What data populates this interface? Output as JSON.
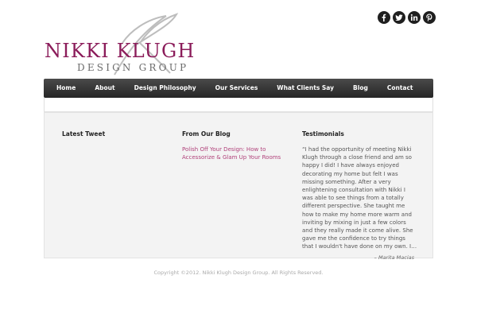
{
  "social": {
    "facebook": "facebook-icon",
    "twitter": "twitter-icon",
    "linkedin": "linkedin-icon",
    "pinterest": "pinterest-icon"
  },
  "logo": {
    "name": "NIKKI KLUGH",
    "subtitle": "DESIGN GROUP",
    "name_color": "#8b1c5a"
  },
  "nav": {
    "items": [
      {
        "label": "Home"
      },
      {
        "label": "About"
      },
      {
        "label": "Design Philosophy"
      },
      {
        "label": "Our Services"
      },
      {
        "label": "What Clients Say"
      },
      {
        "label": "Blog"
      },
      {
        "label": "Contact"
      }
    ]
  },
  "widgets": {
    "latest_tweet": {
      "title": "Latest Tweet"
    },
    "blog": {
      "title": "From Our Blog",
      "link": "Polish Off Your Design: How to Accessorize & Glam Up Your Rooms"
    },
    "testimonials": {
      "title": "Testimonials",
      "quote": "“I had the opportunity of meeting Nikki Klugh through a close friend and am so happy I did!  I have always enjoyed decorating my home but felt I was missing something.  After a very enlightening consultation with Nikki I was able to see things from a totally different perspective.  She taught me how to make my home more warm and inviting by mixing in just a few colors and they really made it come alive.  She gave me the confidence to try things that I wouldn't have done on my own. I…",
      "author": "– Marita Macias"
    }
  },
  "footer": {
    "copyright": "Copyright ©2012. Nikki Klugh Design Group. All Rights Reserved."
  },
  "colors": {
    "nav_bg": "#2e2e2e",
    "link": "#b0417a",
    "widget_bg": "#f3f3f3"
  }
}
